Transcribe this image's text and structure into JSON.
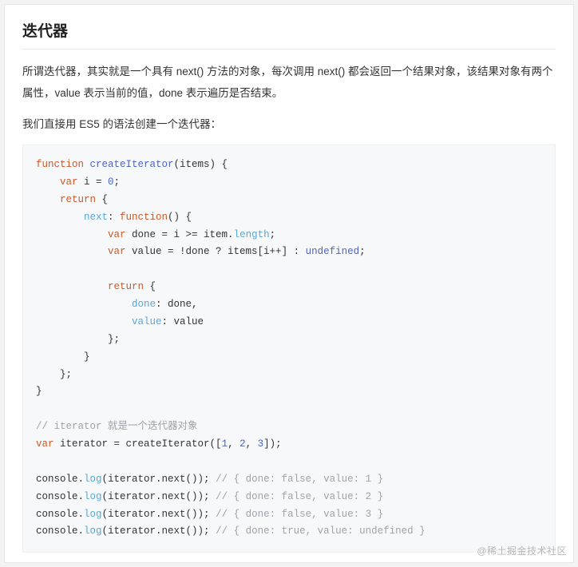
{
  "heading": "迭代器",
  "para1": "所谓迭代器，其实就是一个具有 next() 方法的对象，每次调用 next() 都会返回一个结果对象，该结果对象有两个属性，value 表示当前的值，done 表示遍历是否结束。",
  "para2": "我们直接用 ES5 的语法创建一个迭代器：",
  "watermark": "@稀土掘金技术社区",
  "code": {
    "l01a": "function",
    "l01b": " createIterator",
    "l01c": "(items) {",
    "l02a": "    var",
    "l02b": " i = ",
    "l02c": "0",
    "l02d": ";",
    "l03a": "    return",
    "l03b": " {",
    "l04a": "        next",
    "l04b": ": ",
    "l04c": "function",
    "l04d": "() {",
    "l05a": "            var",
    "l05b": " done = i >= item.",
    "l05c": "length",
    "l05d": ";",
    "l06a": "            var",
    "l06b": " value = !done ? items[i++] : ",
    "l06c": "undefined",
    "l06d": ";",
    "l07": "",
    "l08a": "            return",
    "l08b": " {",
    "l09a": "                done",
    "l09b": ": done,",
    "l10a": "                value",
    "l10b": ": value",
    "l11": "            };",
    "l12": "        }",
    "l13": "    };",
    "l14": "}",
    "l15": "",
    "l16": "// iterator 就是一个迭代器对象",
    "l17a": "var",
    "l17b": " iterator = createIterator([",
    "l17c": "1",
    "l17d": ", ",
    "l17e": "2",
    "l17f": ", ",
    "l17g": "3",
    "l17h": "]);",
    "l18": "",
    "l19a": "console.",
    "l19b": "log",
    "l19c": "(iterator.next()); ",
    "l19d": "// { done: false, value: 1 }",
    "l20a": "console.",
    "l20b": "log",
    "l20c": "(iterator.next()); ",
    "l20d": "// { done: false, value: 2 }",
    "l21a": "console.",
    "l21b": "log",
    "l21c": "(iterator.next()); ",
    "l21d": "// { done: false, value: 3 }",
    "l22a": "console.",
    "l22b": "log",
    "l22c": "(iterator.next()); ",
    "l22d": "// { done: true, value: undefined }"
  }
}
